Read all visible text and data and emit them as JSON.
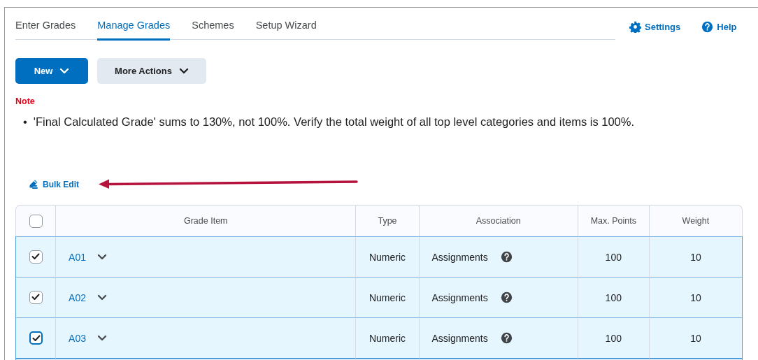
{
  "tabs": [
    {
      "label": "Enter Grades",
      "selected": false
    },
    {
      "label": "Manage Grades",
      "selected": true
    },
    {
      "label": "Schemes",
      "selected": false
    },
    {
      "label": "Setup Wizard",
      "selected": false
    }
  ],
  "header_links": [
    {
      "label": "Settings",
      "kind": "settings"
    },
    {
      "label": "Help",
      "kind": "help"
    }
  ],
  "buttons": [
    {
      "label": "New",
      "kind": "primary"
    },
    {
      "label": "More Actions",
      "kind": "secondary"
    }
  ],
  "note": {
    "title": "Note",
    "bullet": "•",
    "messages": [
      "'Final Calculated Grade' sums to 130%, not 100%. Verify the total weight of all top level categories and items is 100%."
    ]
  },
  "bulk_edit": {
    "label": "Bulk Edit"
  },
  "table": {
    "select_all_checked": false,
    "columns": [
      "Grade Item",
      "Type",
      "Association",
      "Max. Points",
      "Weight"
    ],
    "rows": [
      {
        "item": "A01",
        "type": "Numeric",
        "association": "Assignments",
        "max_points": "100",
        "weight": "10",
        "checked": true,
        "focused": false
      },
      {
        "item": "A02",
        "type": "Numeric",
        "association": "Assignments",
        "max_points": "100",
        "weight": "10",
        "checked": true,
        "focused": false
      },
      {
        "item": "A03",
        "type": "Numeric",
        "association": "Assignments",
        "max_points": "100",
        "weight": "10",
        "checked": true,
        "focused": true
      }
    ]
  }
}
